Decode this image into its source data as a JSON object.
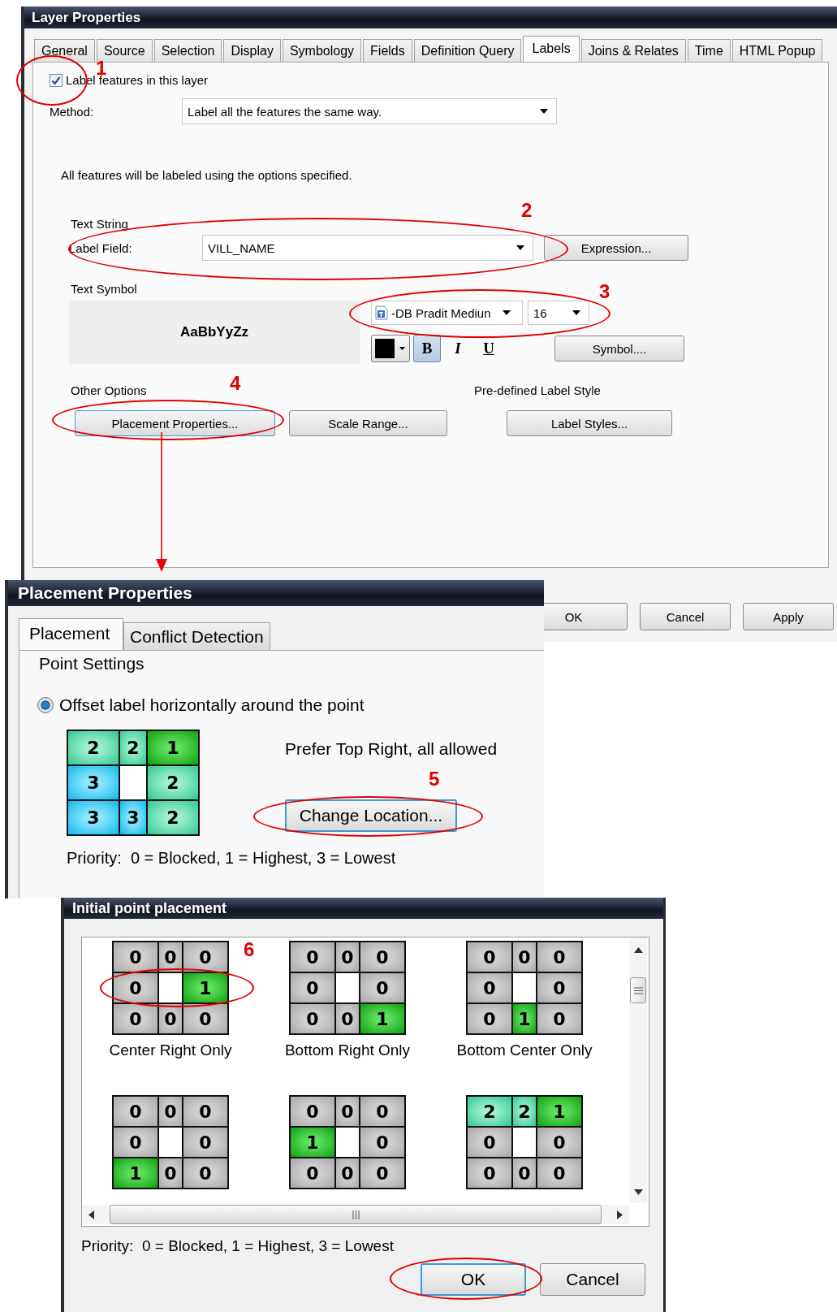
{
  "layer_properties": {
    "title": "Layer Properties",
    "tabs": [
      {
        "label": "General",
        "selected": false
      },
      {
        "label": "Source",
        "selected": false
      },
      {
        "label": "Selection",
        "selected": false
      },
      {
        "label": "Display",
        "selected": false
      },
      {
        "label": "Symbology",
        "selected": false
      },
      {
        "label": "Fields",
        "selected": false
      },
      {
        "label": "Definition Query",
        "selected": false
      },
      {
        "label": "Labels",
        "selected": true
      },
      {
        "label": "Joins & Relates",
        "selected": false
      },
      {
        "label": "Time",
        "selected": false
      },
      {
        "label": "HTML Popup",
        "selected": false
      }
    ],
    "label_features": {
      "label": "Label features in this layer",
      "checked": true
    },
    "method": {
      "label": "Method:",
      "value": "Label all the features the same way."
    },
    "note": "All features will be labeled using the options specified.",
    "text_string": {
      "heading": "Text String",
      "label": "Label Field:",
      "value": "VILL_NAME",
      "button": "Expression..."
    },
    "text_symbol": {
      "heading": "Text Symbol",
      "preview": "AaBbYyZz",
      "font": "-DB Pradit Mediun",
      "size": "16",
      "styles": [
        {
          "label": "B",
          "selected": true
        },
        {
          "label": "I",
          "selected": false
        },
        {
          "label": "U",
          "selected": false
        }
      ],
      "button": "Symbol...."
    },
    "other_options": {
      "heading": "Other Options",
      "buttons": [
        "Placement Properties...",
        "Scale Range..."
      ]
    },
    "label_style": {
      "heading": "Pre-defined Label Style",
      "button": "Label Styles..."
    },
    "buttons": [
      "OK",
      "Cancel",
      "Apply"
    ]
  },
  "placement_properties": {
    "title": "Placement Properties",
    "tabs": [
      {
        "label": "Placement",
        "selected": true
      },
      {
        "label": "Conflict Detection",
        "selected": false
      }
    ],
    "heading": "Point Settings",
    "option": {
      "label": "Offset label horizontally around the point",
      "selected": true
    },
    "grid": [
      {
        "value": "2",
        "kind": "second"
      },
      {
        "value": "2",
        "kind": "second"
      },
      {
        "value": "1",
        "kind": "best"
      },
      {
        "value": "3",
        "kind": "third"
      },
      {
        "kind": "point"
      },
      {
        "value": "2",
        "kind": "second"
      },
      {
        "value": "3",
        "kind": "third"
      },
      {
        "value": "3",
        "kind": "third"
      },
      {
        "value": "2",
        "kind": "second"
      }
    ],
    "description": "Prefer Top Right, all allowed",
    "button": "Change Location...",
    "priority": "Priority:  0 = Blocked, 1 = Highest, 3 = Lowest"
  },
  "initial_point_placement": {
    "title": "Initial point placement",
    "options": [
      {
        "caption": "Center Right Only",
        "cells": [
          {
            "value": "0",
            "kind": "blocked"
          },
          {
            "value": "0",
            "kind": "blocked"
          },
          {
            "value": "0",
            "kind": "blocked"
          },
          {
            "value": "0",
            "kind": "blocked"
          },
          {
            "kind": "point"
          },
          {
            "value": "1",
            "kind": "best"
          },
          {
            "value": "0",
            "kind": "blocked"
          },
          {
            "value": "0",
            "kind": "blocked"
          },
          {
            "value": "0",
            "kind": "blocked"
          }
        ]
      },
      {
        "caption": "Bottom Right Only",
        "cells": [
          {
            "value": "0",
            "kind": "blocked"
          },
          {
            "value": "0",
            "kind": "blocked"
          },
          {
            "value": "0",
            "kind": "blocked"
          },
          {
            "value": "0",
            "kind": "blocked"
          },
          {
            "kind": "point"
          },
          {
            "value": "0",
            "kind": "blocked"
          },
          {
            "value": "0",
            "kind": "blocked"
          },
          {
            "value": "0",
            "kind": "blocked"
          },
          {
            "value": "1",
            "kind": "best"
          }
        ]
      },
      {
        "caption": "Bottom Center Only",
        "cells": [
          {
            "value": "0",
            "kind": "blocked"
          },
          {
            "value": "0",
            "kind": "blocked"
          },
          {
            "value": "0",
            "kind": "blocked"
          },
          {
            "value": "0",
            "kind": "blocked"
          },
          {
            "kind": "point"
          },
          {
            "value": "0",
            "kind": "blocked"
          },
          {
            "value": "0",
            "kind": "blocked"
          },
          {
            "value": "1",
            "kind": "best"
          },
          {
            "value": "0",
            "kind": "blocked"
          }
        ]
      },
      {
        "cells": [
          {
            "value": "0",
            "kind": "blocked"
          },
          {
            "value": "0",
            "kind": "blocked"
          },
          {
            "value": "0",
            "kind": "blocked"
          },
          {
            "value": "0",
            "kind": "blocked"
          },
          {
            "kind": "point"
          },
          {
            "value": "0",
            "kind": "blocked"
          },
          {
            "value": "1",
            "kind": "best"
          },
          {
            "value": "0",
            "kind": "blocked"
          },
          {
            "value": "0",
            "kind": "blocked"
          }
        ]
      },
      {
        "cells": [
          {
            "value": "0",
            "kind": "blocked"
          },
          {
            "value": "0",
            "kind": "blocked"
          },
          {
            "value": "0",
            "kind": "blocked"
          },
          {
            "value": "1",
            "kind": "best"
          },
          {
            "kind": "point"
          },
          {
            "value": "0",
            "kind": "blocked"
          },
          {
            "value": "0",
            "kind": "blocked"
          },
          {
            "value": "0",
            "kind": "blocked"
          },
          {
            "value": "0",
            "kind": "blocked"
          }
        ]
      },
      {
        "cells": [
          {
            "value": "2",
            "kind": "second"
          },
          {
            "value": "2",
            "kind": "second"
          },
          {
            "value": "1",
            "kind": "best"
          },
          {
            "value": "0",
            "kind": "blocked"
          },
          {
            "kind": "point"
          },
          {
            "value": "0",
            "kind": "blocked"
          },
          {
            "value": "0",
            "kind": "blocked"
          },
          {
            "value": "0",
            "kind": "blocked"
          },
          {
            "value": "0",
            "kind": "blocked"
          }
        ]
      }
    ],
    "priority": "Priority:  0 = Blocked, 1 = Highest, 3 = Lowest",
    "buttons": [
      "OK",
      "Cancel"
    ],
    "ok_highlighted": true
  },
  "annotations": [
    {
      "number": "1"
    },
    {
      "number": "2"
    },
    {
      "number": "3"
    },
    {
      "number": "4"
    },
    {
      "number": "5"
    },
    {
      "number": "6"
    }
  ]
}
